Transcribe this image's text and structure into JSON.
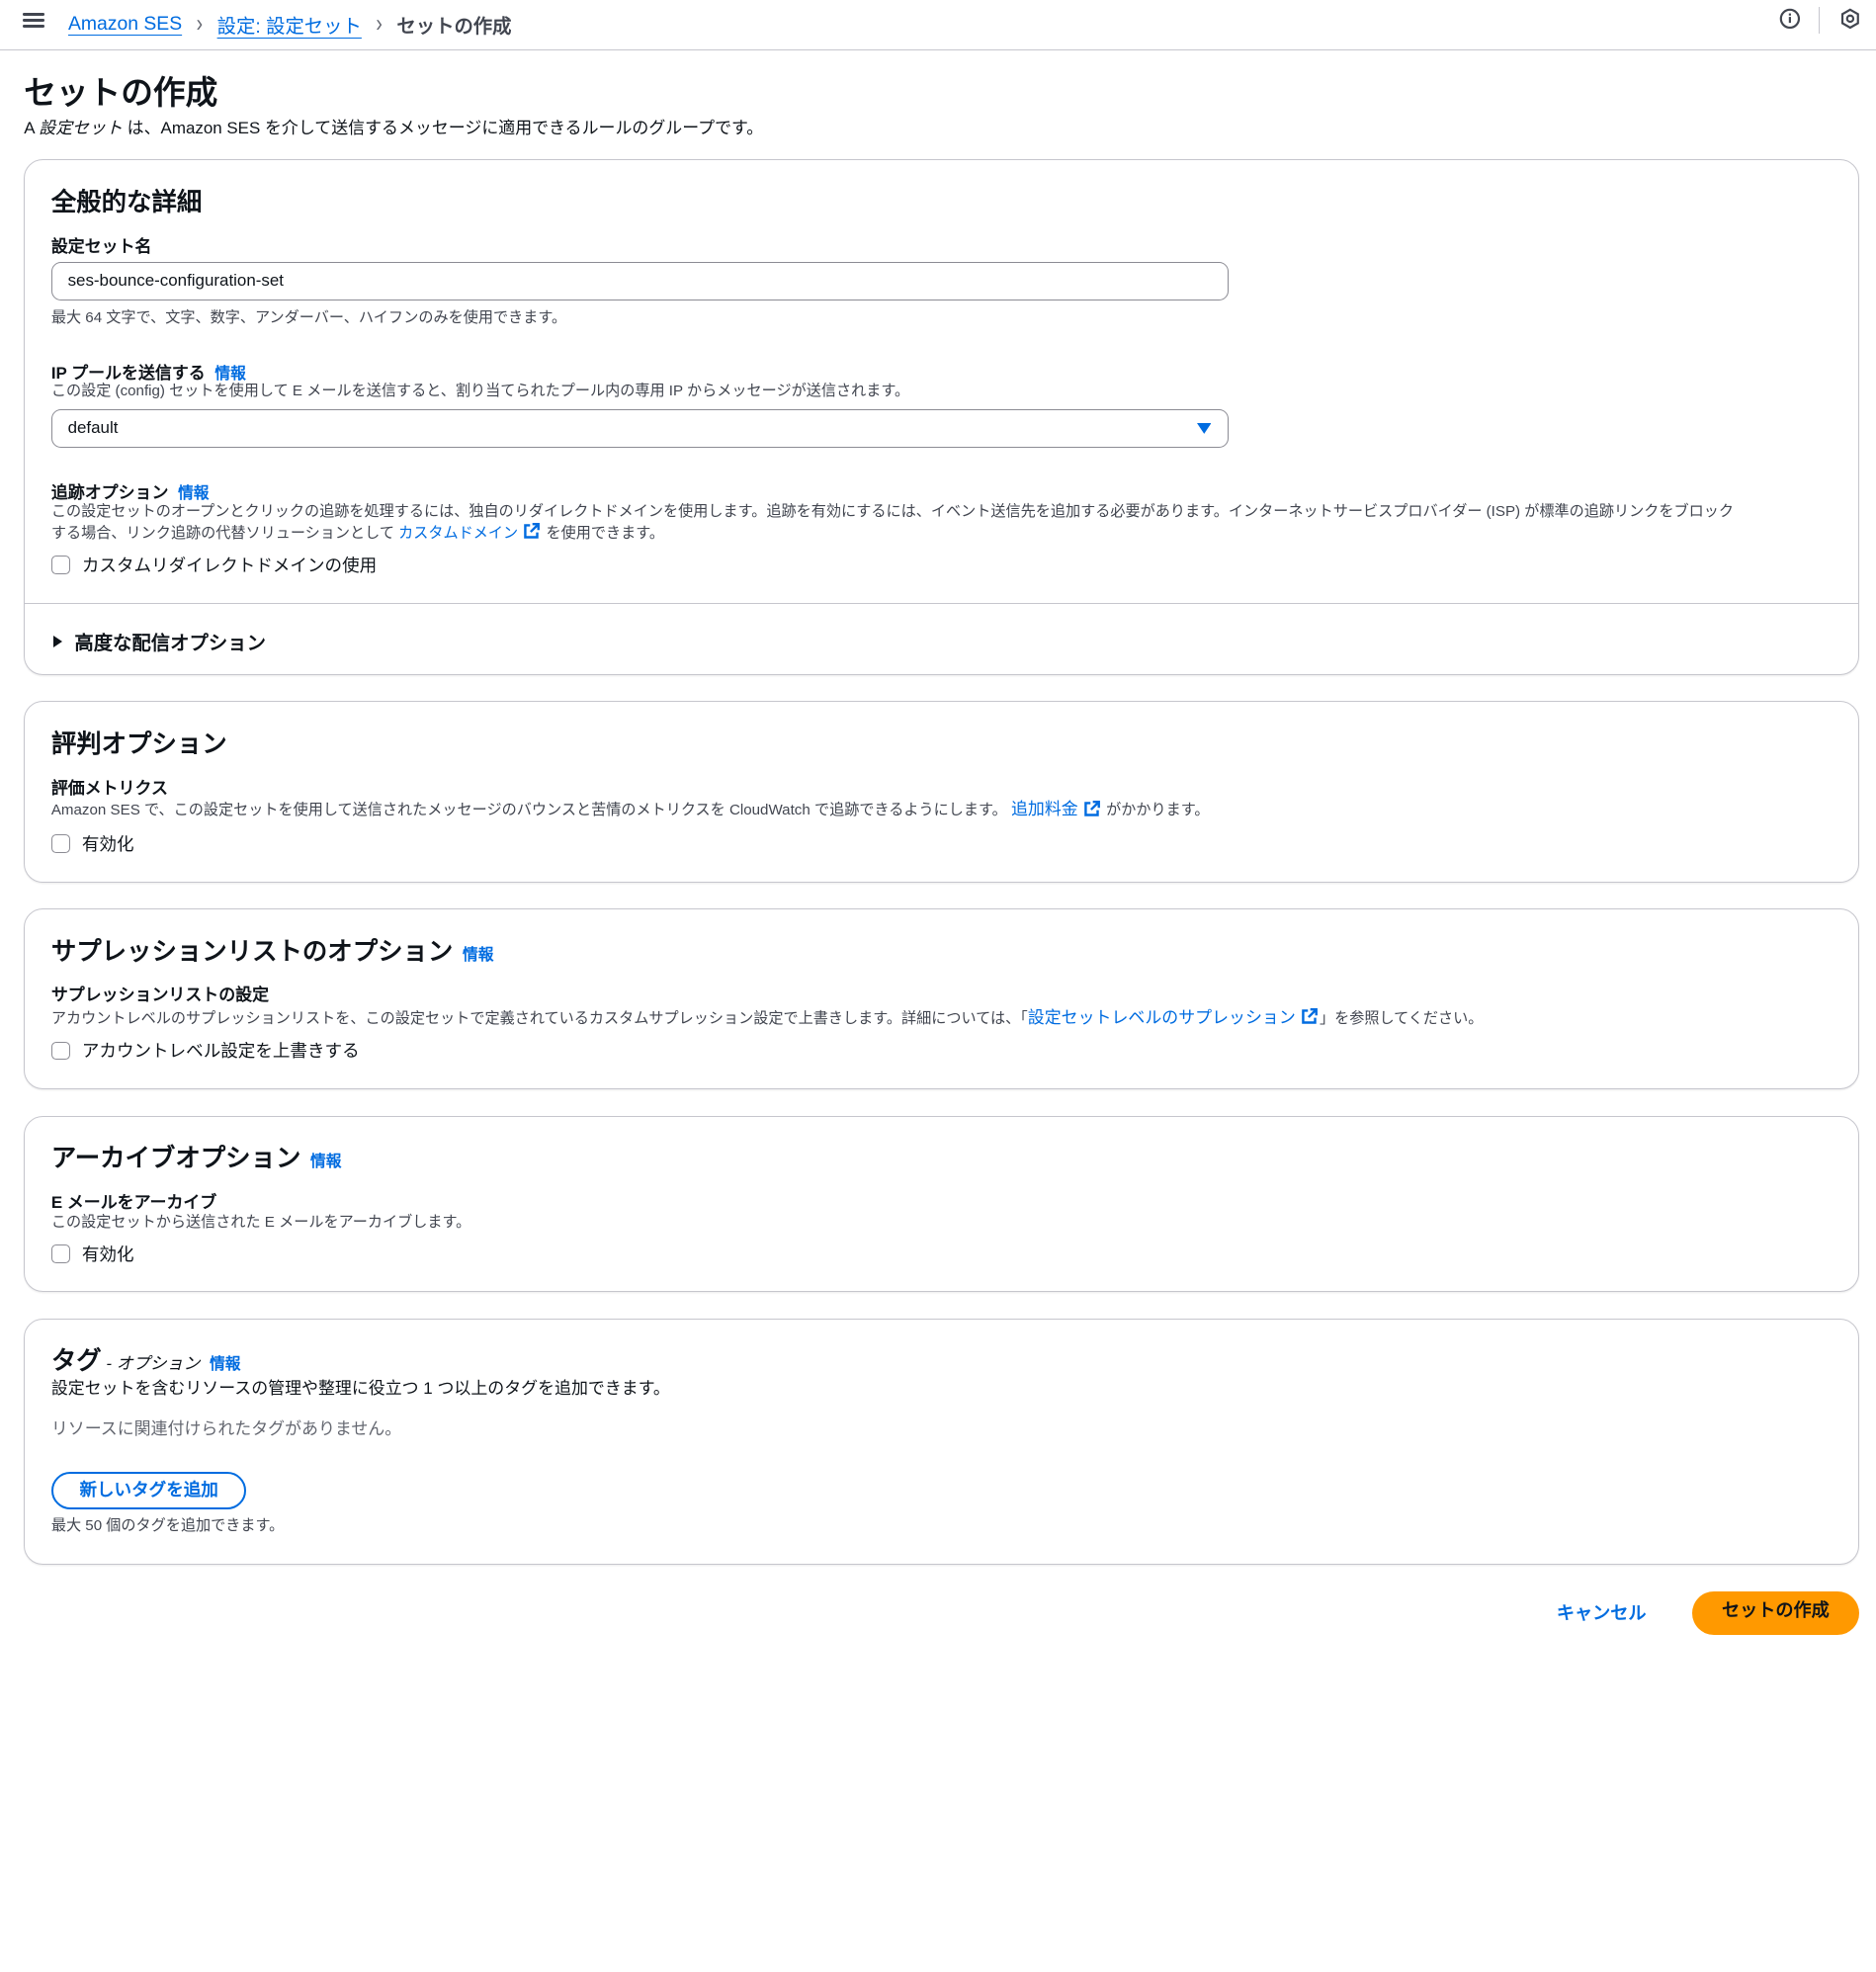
{
  "breadcrumb": {
    "items": [
      "Amazon SES",
      "設定: 設定セット"
    ],
    "current": "セットの作成"
  },
  "page": {
    "title": "セットの作成",
    "desc_prefix": "A ",
    "desc_em": "設定セット",
    "desc_suffix": " は、Amazon SES を介して送信するメッセージに適用できるルールのグループです。"
  },
  "general": {
    "title": "全般的な詳細",
    "name_label": "設定セット名",
    "name_value": "ses-bounce-configuration-set",
    "name_hint": "最大 64 文字で、文字、数字、アンダーバー、ハイフンのみを使用できます。",
    "ip_label": "IP プールを送信する",
    "info": "情報",
    "ip_desc": "この設定 (config) セットを使用して E メールを送信すると、割り当てられたプール内の専用 IP からメッセージが送信されます。",
    "ip_value": "default",
    "tracking_label": "追跡オプション",
    "tracking_desc_1": "この設定セットのオープンとクリックの追跡を処理するには、独自のリダイレクトドメインを使用します。追跡を有効にするには、イベント送信先を追加する必要があります。インターネットサービスプロバイダー (ISP) が標準の追跡リンクをブロック",
    "tracking_desc_2": "する場合、リンク追跡の代替ソリューションとして ",
    "tracking_link": "カスタムドメイン",
    "tracking_desc_3": " を使用できます。",
    "custom_domain_checkbox": "カスタムリダイレクトドメインの使用",
    "advanced": "高度な配信オプション"
  },
  "reputation": {
    "title": "評判オプション",
    "label": "評価メトリクス",
    "desc_1": "Amazon SES で、この設定セットを使用して送信されたメッセージのバウンスと苦情のメトリクスを CloudWatch で追跡できるようにします。",
    "link": "追加料金",
    "desc_2": " がかかります。",
    "checkbox": "有効化"
  },
  "suppression": {
    "title": "サプレッションリストのオプション",
    "info": "情報",
    "label": "サプレッションリストの設定",
    "desc_1": "アカウントレベルのサプレッションリストを、この設定セットで定義されているカスタムサプレッション設定で上書きします。詳細については、「",
    "link": "設定セットレベルのサプレッション",
    "desc_2": "」を参照してください。",
    "checkbox": "アカウントレベル設定を上書きする"
  },
  "archive": {
    "title": "アーカイブオプション",
    "info": "情報",
    "label": "E メールをアーカイブ",
    "desc": "この設定セットから送信された E メールをアーカイブします。",
    "checkbox": "有効化"
  },
  "tags": {
    "title": "タグ",
    "optional": " - オプション",
    "info": "情報",
    "desc": "設定セットを含むリソースの管理や整理に役立つ 1 つ以上のタグを追加できます。",
    "empty": "リソースに関連付けられたタグがありません。",
    "add_button": "新しいタグを追加",
    "limit": "最大 50 個のタグを追加できます。"
  },
  "footer": {
    "cancel": "キャンセル",
    "create": "セットの作成"
  },
  "colors": {
    "link": "#006ce0",
    "primary": "#ff9900",
    "border": "#c6c6cd"
  }
}
